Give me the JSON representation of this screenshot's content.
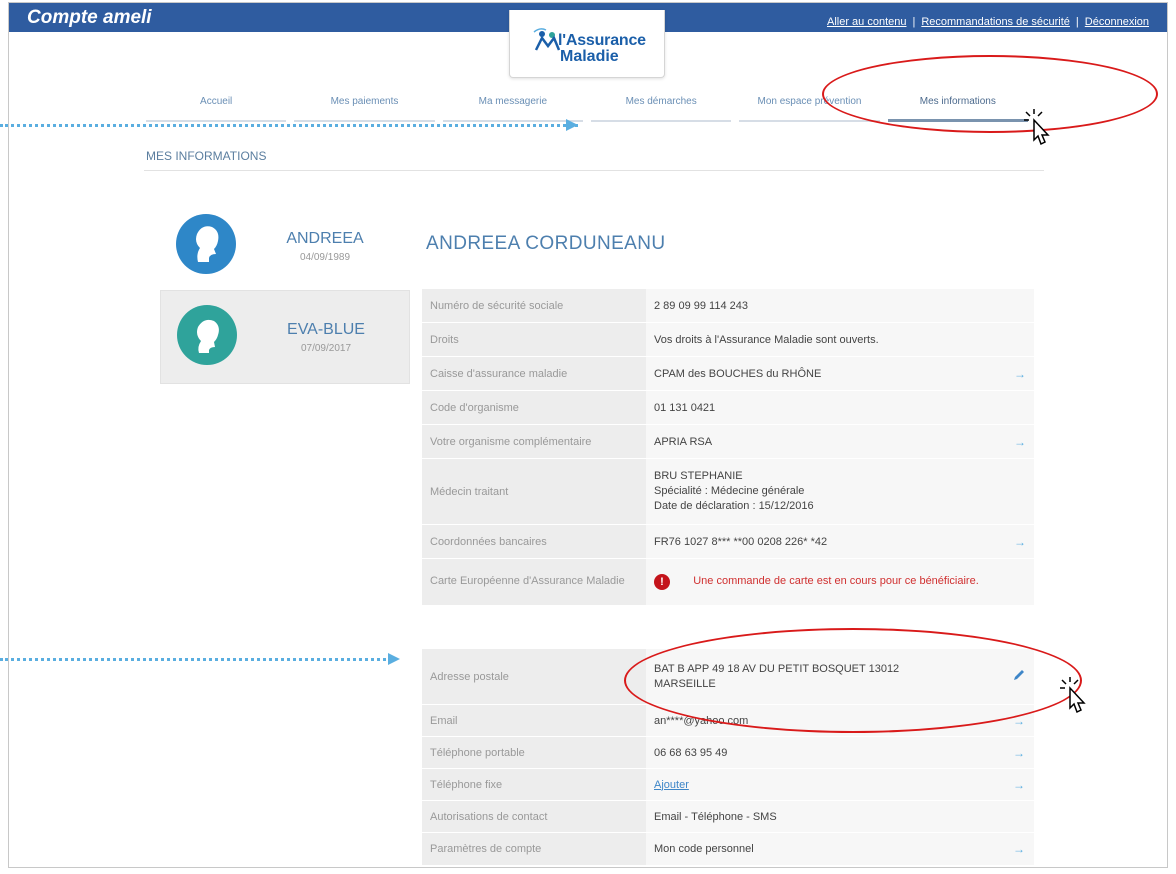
{
  "header": {
    "brand": "Compte ameli",
    "links": [
      "Aller au contenu",
      "Recommandations de sécurité",
      "Déconnexion"
    ],
    "logo_line1": "l'Assurance",
    "logo_line2": "Maladie"
  },
  "nav": {
    "items": [
      "Accueil",
      "Mes paiements",
      "Ma messagerie",
      "Mes démarches",
      "Mon espace prévention",
      "Mes informations"
    ],
    "active": "Mes informations"
  },
  "section_title": "MES INFORMATIONS",
  "profiles": [
    {
      "name": "ANDREEA",
      "date": "04/09/1989"
    },
    {
      "name": "EVA-BLUE",
      "date": "07/09/2017"
    }
  ],
  "person_title": "ANDREEA CORDUNEANU",
  "info_rows": [
    {
      "label": "Numéro de sécurité sociale",
      "value": "2 89 09 99 114 243",
      "arrow": false
    },
    {
      "label": "Droits",
      "value": "Vos droits à l'Assurance Maladie sont ouverts.",
      "arrow": false
    },
    {
      "label": "Caisse d'assurance maladie",
      "value": "CPAM des BOUCHES du RHÔNE",
      "arrow": true
    },
    {
      "label": "Code d'organisme",
      "value": "01 131 0421",
      "arrow": false
    },
    {
      "label": "Votre organisme complémentaire",
      "value": "APRIA RSA",
      "arrow": true
    },
    {
      "label": "Médecin traitant",
      "value_lines": [
        "BRU STEPHANIE",
        "Spécialité : Médecine générale",
        "Date de déclaration : 15/12/2016"
      ],
      "arrow": false
    },
    {
      "label": "Coordonnées bancaires",
      "value": "FR76 1027 8*** **00 0208 226* *42",
      "arrow": true
    },
    {
      "label": "Carte Européenne d'Assurance Maladie",
      "warning": "Une commande de carte est en cours pour ce bénéficiaire.",
      "warning_icon": "!",
      "arrow": false
    }
  ],
  "contact_rows": [
    {
      "label": "Adresse postale",
      "value": "BAT B APP 49 18 AV DU PETIT BOSQUET 13012 MARSEILLE",
      "action_icon": "pencil-icon"
    },
    {
      "label": "Email",
      "value": "an****@yahoo.com",
      "action_icon": "arrow-right-icon"
    },
    {
      "label": "Téléphone portable",
      "value": "06 68 63 95 49",
      "action_icon": "arrow-right-icon"
    },
    {
      "label": "Téléphone fixe",
      "value": "Ajouter",
      "action_icon": "arrow-right-icon"
    },
    {
      "label": "Autorisations de contact",
      "value": "Email - Téléphone - SMS",
      "action_icon": ""
    },
    {
      "label": "Paramètres de compte",
      "value": "Mon code personnel",
      "action_icon": "arrow-right-icon"
    }
  ],
  "colors": {
    "topbar": "#2f5ca0",
    "accent_blue": "#4d7fae",
    "highlight_red": "#d91a1a",
    "dotted_arrow": "#5aaee0",
    "warning_red": "#c4141b"
  }
}
